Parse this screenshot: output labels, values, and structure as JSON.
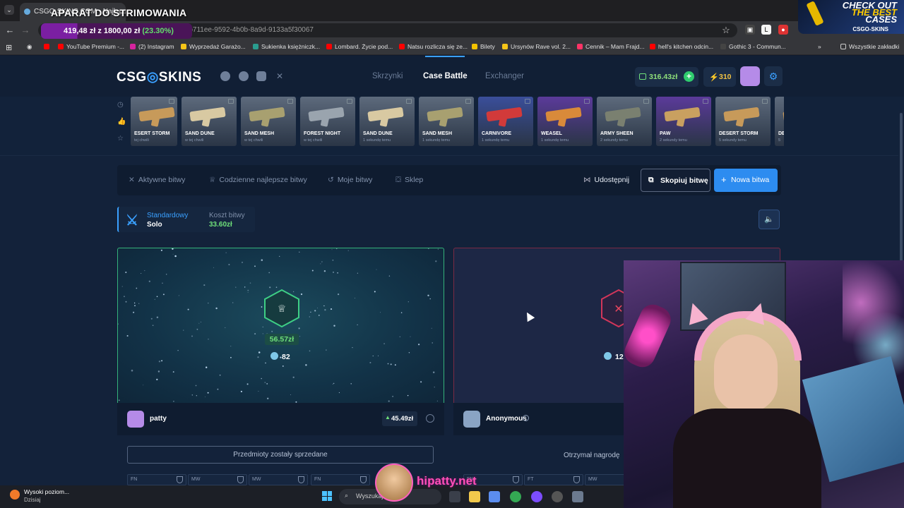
{
  "browser": {
    "tab_title": "CSGO-SKINS.COM - Najlepsze...",
    "overlay_title": "APARAT DO STRIMOWANIA",
    "url": "/bcb711ee-9592-4b0b-8a9d-9133a5f30067",
    "donation_goal": "419,48 zł z 1800,00 zł",
    "donation_pct": "(23.30%)",
    "promo": {
      "l1": "CHECK OUT",
      "l2": "THE BEST",
      "l3": "CASES",
      "brand": "CSGO-SKINS"
    },
    "bookmarks": [
      {
        "label": "YouTube Premium -...",
        "color": "#ff0000"
      },
      {
        "label": "(2) Instagram",
        "color": "#d6249f"
      },
      {
        "label": "Wyprzedaż Garażo...",
        "color": "#f5c518"
      },
      {
        "label": "Sukienka księżniczk...",
        "color": "#2a9d8f"
      },
      {
        "label": "Lombard. Życie pod...",
        "color": "#ff0000"
      },
      {
        "label": "Natsu rozlicza się ze...",
        "color": "#ff0000"
      },
      {
        "label": "Bilety",
        "color": "#f2c200"
      },
      {
        "label": "Ursynów Rave vol. 2...",
        "color": "#f5c518"
      },
      {
        "label": "Cennik – Mam Frajd...",
        "color": "#ff3366"
      },
      {
        "label": "hell's kitchen odcin...",
        "color": "#ff0000"
      },
      {
        "label": "Gothic 3 - Commun...",
        "color": "#444"
      }
    ],
    "all_bookmarks": "Wszystkie zakładki"
  },
  "site": {
    "logo_pre": "CSG",
    "logo_post": "SKINS",
    "nav": [
      {
        "label": "Skrzynki",
        "active": false
      },
      {
        "label": "Case Battle",
        "active": true
      },
      {
        "label": "Exchanger",
        "active": false
      }
    ],
    "balance": "316.43zł",
    "coins": "310"
  },
  "drops": [
    {
      "name": "ESERT STORM",
      "time": "tej chwili",
      "gun": "#c79a5a",
      "bg": "#5d6a7c"
    },
    {
      "name": "SAND DUNE",
      "time": "w tej chwili",
      "gun": "#d8c9a2",
      "bg": "#5d6a7c"
    },
    {
      "name": "SAND MESH",
      "time": "w tej chwili",
      "gun": "#a8a070",
      "bg": "#5d6a7c"
    },
    {
      "name": "FOREST NIGHT",
      "time": "w tej chwili",
      "gun": "#9aa4ae",
      "bg": "#5d6a7c"
    },
    {
      "name": "SAND DUNE",
      "time": "1 sekundę temu",
      "gun": "#d8c9a2",
      "bg": "#5d6a7c"
    },
    {
      "name": "SAND MESH",
      "time": "1 sekundę temu",
      "gun": "#a8a070",
      "bg": "#5d6a7c"
    },
    {
      "name": "CARNIVORE",
      "time": "1 sekundę temu",
      "gun": "#d23a3a",
      "bg": "#3a4e9a"
    },
    {
      "name": "WEASEL",
      "time": "1 sekundę temu",
      "gun": "#d98a3a",
      "bg": "#5b3a9a"
    },
    {
      "name": "ARMY SHEEN",
      "time": "2 sekundy temu",
      "gun": "#7a8070",
      "bg": "#5d6a7c"
    },
    {
      "name": "PAW",
      "time": "2 sekundy temu",
      "gun": "#c9a060",
      "bg": "#5b3a9a"
    },
    {
      "name": "DESERT STORM",
      "time": "5 sekundy temu",
      "gun": "#c79a5a",
      "bg": "#5d6a7c"
    },
    {
      "name": "DE",
      "time": "5",
      "gun": "#c79a5a",
      "bg": "#5d6a7c"
    }
  ],
  "battle_tabs": {
    "active": "Aktywne bitwy",
    "daily": "Codzienne najlepsze bitwy",
    "mine": "Moje bitwy",
    "shop": "Sklep",
    "share": "Udostępnij",
    "copy": "Skopiuj bitwę",
    "new": "Nowa bitwa"
  },
  "mode": {
    "type": "Standardowy",
    "players": "Solo",
    "cost_label": "Koszt bitwy",
    "cost": "33.60zł"
  },
  "players": [
    {
      "name": "patty",
      "win_amount": "56.57zł",
      "coins": "82",
      "profit": "45.49zł",
      "status": "Przedmioty zostały sprzedane",
      "color": "#b58be8"
    },
    {
      "name": "Anonymous",
      "coins": "12",
      "status": "Otrzymał nagrodę",
      "color": "#8aa4c4"
    }
  ],
  "conditions": [
    "FN",
    "MW",
    "MW",
    "FN",
    "FN",
    "FT",
    "MW"
  ],
  "taskbar": {
    "notif": "Wysoki poziom...",
    "notif_sub": "Dzisiaj",
    "search": "Wyszukaj",
    "watermark": "hipatty.net"
  }
}
